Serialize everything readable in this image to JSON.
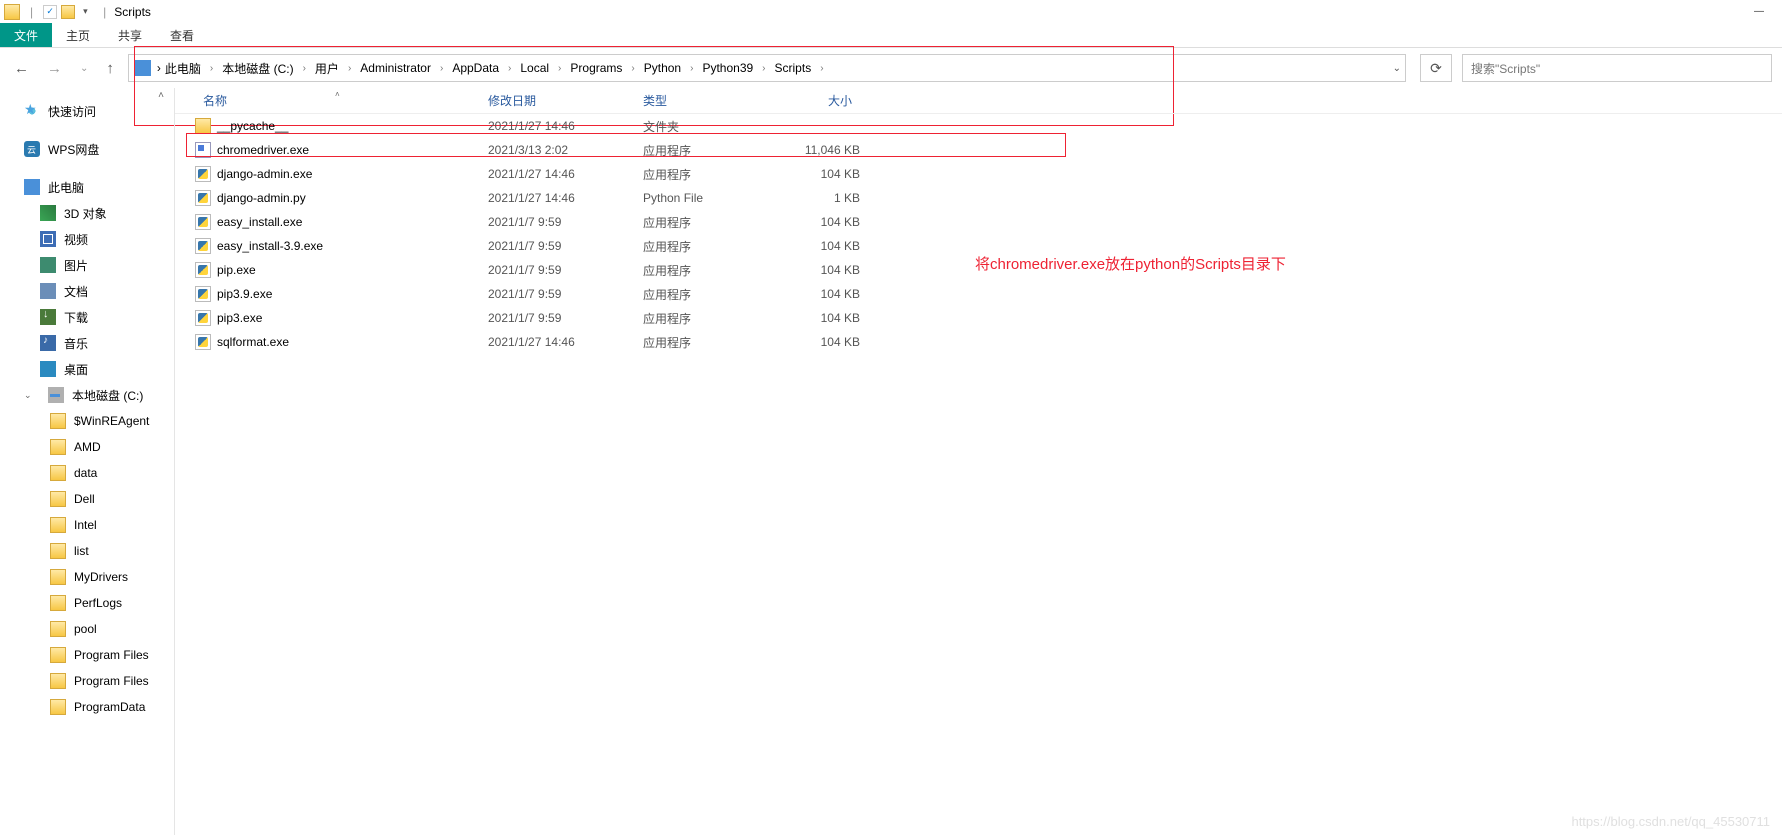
{
  "window": {
    "title": "Scripts",
    "minimize": "—"
  },
  "ribbon": {
    "file": "文件",
    "home": "主页",
    "share": "共享",
    "view": "查看"
  },
  "nav": {
    "search_placeholder": "搜索\"Scripts\"",
    "breadcrumb": [
      "此电脑",
      "本地磁盘 (C:)",
      "用户",
      "Administrator",
      "AppData",
      "Local",
      "Programs",
      "Python",
      "Python39",
      "Scripts"
    ]
  },
  "sidebar": {
    "quick_access": "快速访问",
    "wps": "WPS网盘",
    "this_pc": "此电脑",
    "pc_children": [
      {
        "label": "3D 对象",
        "icon": "cube"
      },
      {
        "label": "视频",
        "icon": "video"
      },
      {
        "label": "图片",
        "icon": "pic"
      },
      {
        "label": "文档",
        "icon": "doc"
      },
      {
        "label": "下载",
        "icon": "dl"
      },
      {
        "label": "音乐",
        "icon": "music"
      },
      {
        "label": "桌面",
        "icon": "desk"
      },
      {
        "label": "本地磁盘 (C:)",
        "icon": "disk",
        "expanded": true
      }
    ],
    "disk_children": [
      "$WinREAgent",
      "AMD",
      "data",
      "Dell",
      "Intel",
      "list",
      "MyDrivers",
      "PerfLogs",
      "pool",
      "Program Files",
      "Program Files",
      "ProgramData"
    ]
  },
  "columns": {
    "name": "名称",
    "date": "修改日期",
    "type": "类型",
    "size": "大小"
  },
  "files": [
    {
      "name": "__pycache__",
      "date": "2021/1/27 14:46",
      "type": "文件夹",
      "size": "",
      "icon": "folder"
    },
    {
      "name": "chromedriver.exe",
      "date": "2021/3/13 2:02",
      "type": "应用程序",
      "size": "11,046 KB",
      "icon": "exe",
      "highlight": true
    },
    {
      "name": "django-admin.exe",
      "date": "2021/1/27 14:46",
      "type": "应用程序",
      "size": "104 KB",
      "icon": "pyexe"
    },
    {
      "name": "django-admin.py",
      "date": "2021/1/27 14:46",
      "type": "Python File",
      "size": "1 KB",
      "icon": "py"
    },
    {
      "name": "easy_install.exe",
      "date": "2021/1/7 9:59",
      "type": "应用程序",
      "size": "104 KB",
      "icon": "pyexe"
    },
    {
      "name": "easy_install-3.9.exe",
      "date": "2021/1/7 9:59",
      "type": "应用程序",
      "size": "104 KB",
      "icon": "pyexe"
    },
    {
      "name": "pip.exe",
      "date": "2021/1/7 9:59",
      "type": "应用程序",
      "size": "104 KB",
      "icon": "pyexe"
    },
    {
      "name": "pip3.9.exe",
      "date": "2021/1/7 9:59",
      "type": "应用程序",
      "size": "104 KB",
      "icon": "pyexe"
    },
    {
      "name": "pip3.exe",
      "date": "2021/1/7 9:59",
      "type": "应用程序",
      "size": "104 KB",
      "icon": "pyexe"
    },
    {
      "name": "sqlformat.exe",
      "date": "2021/1/27 14:46",
      "type": "应用程序",
      "size": "104 KB",
      "icon": "pyexe"
    }
  ],
  "annotation": "将chromedriver.exe放在python的Scripts目录下",
  "watermark": "https://blog.csdn.net/qq_45530711"
}
